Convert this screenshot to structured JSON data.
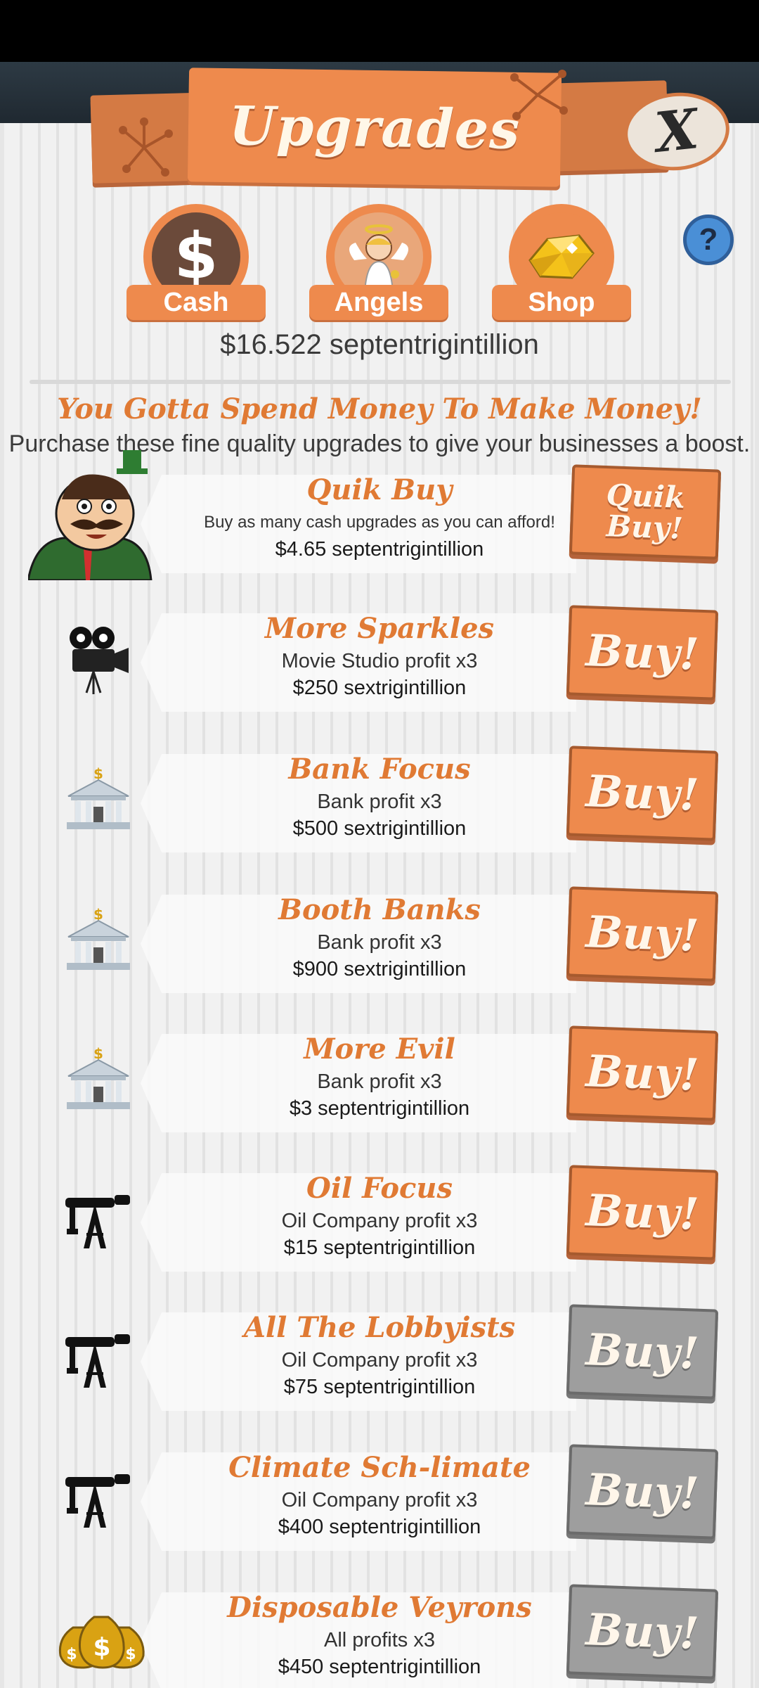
{
  "header": {
    "title": "Upgrades",
    "close_label": "X"
  },
  "tabs": [
    {
      "label": "Cash",
      "icon": "dollar-icon"
    },
    {
      "label": "Angels",
      "icon": "angel-icon"
    },
    {
      "label": "Shop",
      "icon": "gold-gem-icon"
    }
  ],
  "help_label": "?",
  "balance": "$16.522 septentrigintillion",
  "slogan": "You Gotta Spend Money To Make Money!",
  "subtext": "Purchase these fine quality upgrades to give your businesses a boost.",
  "quik_buy": {
    "name": "Quik Buy",
    "desc": "Buy as many cash upgrades as you can afford!",
    "price": "$4.65 septentrigintillion",
    "button_line1": "Quik",
    "button_line2": "Buy!"
  },
  "buy_label": "Buy!",
  "upgrades": [
    {
      "name": "More Sparkles",
      "desc": "Movie Studio profit x3",
      "price": "$250 sextrigintillion",
      "icon": "movie-camera-icon",
      "affordable": true
    },
    {
      "name": "Bank Focus",
      "desc": "Bank profit x3",
      "price": "$500 sextrigintillion",
      "icon": "bank-icon",
      "affordable": true
    },
    {
      "name": "Booth Banks",
      "desc": "Bank profit x3",
      "price": "$900 sextrigintillion",
      "icon": "bank-icon",
      "affordable": true
    },
    {
      "name": "More Evil",
      "desc": "Bank profit x3",
      "price": "$3 septentrigintillion",
      "icon": "bank-icon",
      "affordable": true
    },
    {
      "name": "Oil Focus",
      "desc": "Oil Company profit x3",
      "price": "$15 septentrigintillion",
      "icon": "oil-derrick-icon",
      "affordable": true
    },
    {
      "name": "All The Lobbyists",
      "desc": "Oil Company profit x3",
      "price": "$75 septentrigintillion",
      "icon": "oil-derrick-icon",
      "affordable": false
    },
    {
      "name": "Climate Sch-limate",
      "desc": "Oil Company profit x3",
      "price": "$400 septentrigintillion",
      "icon": "oil-derrick-icon",
      "affordable": false
    },
    {
      "name": "Disposable Veyrons",
      "desc": "All profits x3",
      "price": "$450 septentrigintillion",
      "icon": "money-bags-icon",
      "affordable": false
    }
  ],
  "colors": {
    "accent": "#ee8a4d",
    "accent_dark": "#c9703f",
    "title_orange": "#e07a34",
    "disabled_gray": "#9e9e9e"
  }
}
